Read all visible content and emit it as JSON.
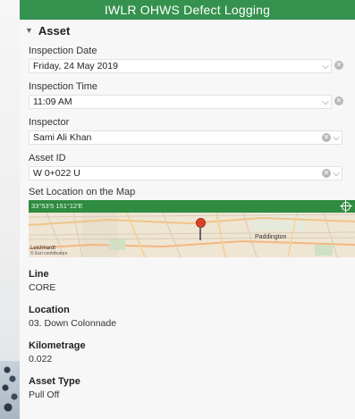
{
  "app": {
    "title": "IWLR OHWS Defect Logging"
  },
  "group": {
    "title": "Asset"
  },
  "fields": {
    "inspection_date": {
      "label": "Inspection Date",
      "value": "Friday, 24 May 2019"
    },
    "inspection_time": {
      "label": "Inspection Time",
      "value": "11:09 AM"
    },
    "inspector": {
      "label": "Inspector",
      "value": "Sami Ali Khan"
    },
    "asset_id": {
      "label": "Asset ID",
      "value": "W 0+022 U"
    }
  },
  "map": {
    "label": "Set Location on the Map",
    "coords": "33°53'5 151°12'E",
    "places": {
      "paddington": "Paddington",
      "leichhardt": "Leichhardt"
    },
    "credit": "© Esri contributors"
  },
  "readonly": {
    "line": {
      "label": "Line",
      "value": "CORE"
    },
    "location": {
      "label": "Location",
      "value": "03. Down Colonnade"
    },
    "kilometrage": {
      "label": "Kilometrage",
      "value": "0.022"
    },
    "asset_type": {
      "label": "Asset Type",
      "value": "Pull Off"
    }
  },
  "icons": {
    "header_collapse": "triangle-down-icon",
    "dropdown": "chevron-down-icon",
    "clear": "clear-icon",
    "gps": "gps-crosshair-icon",
    "pin": "map-pin-icon"
  },
  "colors": {
    "header_green": "#35924e",
    "map_bar_green": "#2e8b3f",
    "pin_red": "#d84327"
  }
}
